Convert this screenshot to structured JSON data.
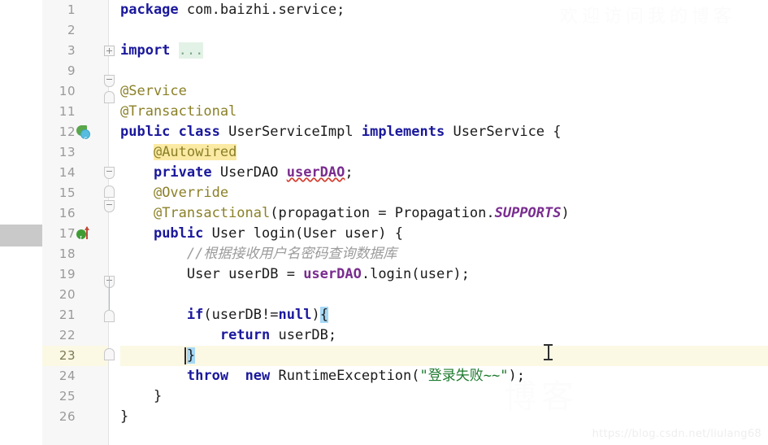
{
  "editor": {
    "language": "java",
    "file_class": "UserServiceImpl",
    "background": "#ffffff",
    "gutter_background": "#f7f7f7",
    "caret_line_background": "#fbf8e4",
    "brace_match_background": "#a6d8f5",
    "annotation_highlight_background": "#fbeaa4"
  },
  "lines": [
    {
      "n": "1",
      "fold": "",
      "icon": ""
    },
    {
      "n": "2",
      "fold": "",
      "icon": ""
    },
    {
      "n": "3",
      "fold": "plus",
      "icon": ""
    },
    {
      "n": "9",
      "fold": "",
      "icon": ""
    },
    {
      "n": "10",
      "fold": "arrow-down",
      "icon": ""
    },
    {
      "n": "11",
      "fold": "arrow-up",
      "icon": ""
    },
    {
      "n": "12",
      "fold": "",
      "icon": "spring-bean-icon"
    },
    {
      "n": "13",
      "fold": "",
      "icon": ""
    },
    {
      "n": "14",
      "fold": "",
      "icon": ""
    },
    {
      "n": "15",
      "fold": "arrow-down",
      "icon": ""
    },
    {
      "n": "16",
      "fold": "arrow-up",
      "icon": ""
    },
    {
      "n": "17",
      "fold": "arrow-down",
      "icon": "implements-override-icon"
    },
    {
      "n": "18",
      "fold": "",
      "icon": ""
    },
    {
      "n": "19",
      "fold": "",
      "icon": ""
    },
    {
      "n": "20",
      "fold": "",
      "icon": ""
    },
    {
      "n": "21",
      "fold": "arrow-down",
      "icon": ""
    },
    {
      "n": "22",
      "fold": "",
      "icon": ""
    },
    {
      "n": "23",
      "fold": "arrow-up",
      "icon": "",
      "caret": true
    },
    {
      "n": "24",
      "fold": "",
      "icon": ""
    },
    {
      "n": "25",
      "fold": "arrow-up",
      "icon": ""
    },
    {
      "n": "26",
      "fold": "",
      "icon": ""
    }
  ],
  "code": {
    "l1_kw": "package",
    "l1_rest": " com.baizhi.service;",
    "l3_kw": "import",
    "l3_ellipsis": "...",
    "l10_ann": "@Service",
    "l11_ann": "@Transactional",
    "l12_kw1": "public",
    "l12_kw2": "class",
    "l12_name": " UserServiceImpl ",
    "l12_kw3": "implements",
    "l12_iface": " UserService {",
    "l13_ann": "@Autowired",
    "l14_kw": "private",
    "l14_type": " UserDAO ",
    "l14_field": "userDAO",
    "l14_semi": ";",
    "l15_ann": "@Override",
    "l16_ann": "@Transactional",
    "l16_args": "(propagation = Propagation.",
    "l16_const": "SUPPORTS",
    "l16_close": ")",
    "l17_kw": "public",
    "l17_sig": " User login(User user) {",
    "l18_comment": "//根据接收用户名密码查询数据库",
    "l19_pre": "User userDB = ",
    "l19_field": "userDAO",
    "l19_post": ".login(user);",
    "l21_kw_if": "if",
    "l21_cond1": "(userDB!=",
    "l21_kw_null": "null",
    "l21_cond2": ")",
    "l21_brace": "{",
    "l22_kw": "return",
    "l22_rest": " userDB;",
    "l23_brace": "}",
    "l24_kw1": "throw",
    "l24_kw2": "new",
    "l24_type": " RuntimeException(",
    "l24_str": "\"登录失败~~\"",
    "l24_end": ");",
    "l25_brace": "}",
    "l26_brace": "}"
  },
  "watermarks": {
    "bottom_right": "https://blog.csdn.net/liulang68",
    "top_right": "欢迎访问我的博客",
    "middle": "博客"
  }
}
